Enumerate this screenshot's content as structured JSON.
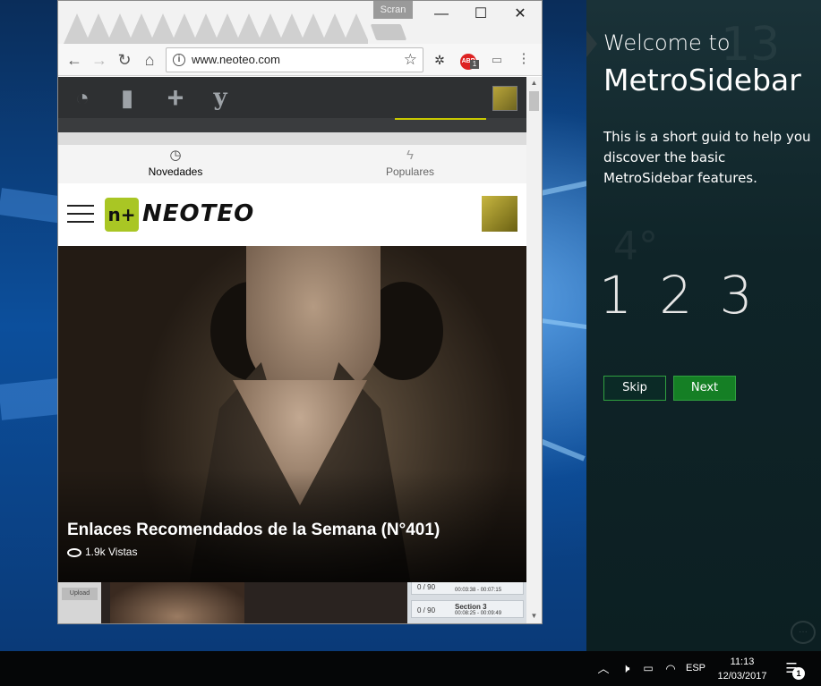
{
  "browser": {
    "tab_tooltip": "Scran",
    "window_controls": {
      "minimize": "—",
      "maximize": "☐",
      "close": "✕"
    },
    "url": "www.neoteo.com",
    "extension_badge": "1"
  },
  "site": {
    "tabs": [
      {
        "label": "Novedades",
        "icon": "clock-icon"
      },
      {
        "label": "Populares",
        "icon": "lightning-icon"
      }
    ],
    "logo_mark": "n+",
    "logo_text": "NEOTEO",
    "article": {
      "headline": "Enlaces Recomendados de la Semana (N°401)",
      "views": "1.9k Vistas"
    },
    "preview_strip": {
      "upload_label": "Upload",
      "rows": [
        {
          "count": "0 / 90",
          "section": "",
          "time": "00:03:38 - 00:07:15"
        },
        {
          "count": "0 / 90",
          "section": "Section 3",
          "time": "00:08:25 - 00:09:49"
        }
      ]
    }
  },
  "metro": {
    "welcome": "Welcome to",
    "app_name": "MetroSidebar",
    "description": "This is a short guid to help you discover the basic MetroSidebar features.",
    "steps": "1 2 3",
    "skip_label": "Skip",
    "next_label": "Next",
    "accent": "#157f25"
  },
  "taskbar": {
    "language": "ESP",
    "time": "11:13",
    "date": "12/03/2017",
    "notification_count": "1"
  }
}
